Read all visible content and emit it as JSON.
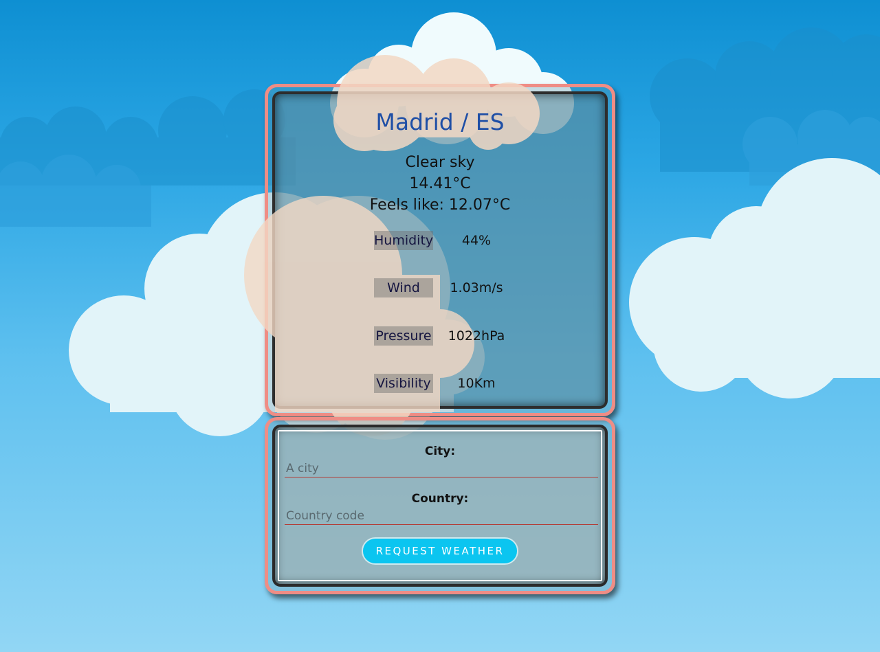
{
  "weather": {
    "location": "Madrid / ES",
    "description": "Clear sky",
    "temperature": "14.41°C",
    "feels_like": "Feels like: 12.07°C",
    "details": [
      {
        "label": "Humidity",
        "value": "44%"
      },
      {
        "label": "Wind",
        "value": "1.03m/s"
      },
      {
        "label": "Pressure",
        "value": "1022hPa"
      },
      {
        "label": "Visibility",
        "value": "10Km"
      }
    ]
  },
  "form": {
    "city_label": "City:",
    "city_placeholder": "A city",
    "country_label": "Country:",
    "country_placeholder": "Country code",
    "submit_label": "REQUEST WEATHER"
  },
  "colors": {
    "accent": "#0bc5f0",
    "card_border": "#ef8d85",
    "title": "#1f4fa6"
  }
}
